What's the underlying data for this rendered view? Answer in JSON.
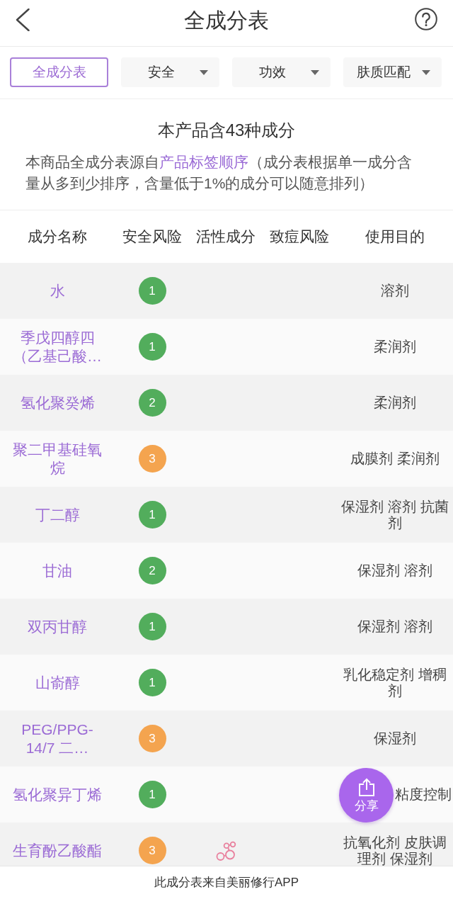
{
  "header": {
    "title": "全成分表"
  },
  "filters": [
    {
      "label": "全成分表",
      "selected": true,
      "dropdown": false
    },
    {
      "label": "安全",
      "selected": false,
      "dropdown": true
    },
    {
      "label": "功效",
      "selected": false,
      "dropdown": true
    },
    {
      "label": "肤质匹配",
      "selected": false,
      "dropdown": true
    }
  ],
  "summary": {
    "title": "本产品含43种成分",
    "text_before": "本商品全成分表源自",
    "link": "产品标签顺序",
    "text_after": "（成分表根据单一成分含量从多到少排序，含量低于1%的成分可以随意排列）"
  },
  "table": {
    "columns": [
      "成分名称",
      "安全风险",
      "活性成分",
      "致痘风险",
      "使用目的"
    ],
    "rows": [
      {
        "name": "水",
        "safety": {
          "score": "1",
          "color": "#52ad5c"
        },
        "active": false,
        "purpose": {
          "text": "溶剂"
        }
      },
      {
        "name": "季戊四醇四（乙基己酸…",
        "safety": {
          "score": "1",
          "color": "#52ad5c"
        },
        "active": false,
        "purpose": {
          "text": "柔润剂"
        }
      },
      {
        "name": "氢化聚癸烯",
        "safety": {
          "score": "2",
          "color": "#52ad5c"
        },
        "active": false,
        "purpose": {
          "text": "柔润剂"
        }
      },
      {
        "name": "聚二甲基硅氧烷",
        "safety": {
          "score": "3",
          "color": "#f4a44f"
        },
        "active": false,
        "purpose": {
          "text": "成膜剂 柔润剂"
        }
      },
      {
        "name": "丁二醇",
        "safety": {
          "score": "1",
          "color": "#52ad5c"
        },
        "active": false,
        "purpose": {
          "text": "保湿剂 溶剂 抗菌剂"
        }
      },
      {
        "name": "甘油",
        "safety": {
          "score": "2",
          "color": "#52ad5c"
        },
        "active": false,
        "purpose": {
          "text": "保湿剂 溶剂"
        }
      },
      {
        "name": "双丙甘醇",
        "safety": {
          "score": "1",
          "color": "#52ad5c"
        },
        "active": false,
        "purpose": {
          "text": "保湿剂 溶剂"
        }
      },
      {
        "name": "山嵛醇",
        "safety": {
          "score": "1",
          "color": "#52ad5c"
        },
        "active": false,
        "purpose": {
          "text": "乳化稳定剂 增稠剂"
        }
      },
      {
        "name": "PEG/PPG-14/7 二…",
        "safety": {
          "score": "3",
          "color": "#f4a44f"
        },
        "active": false,
        "purpose": {
          "text": "保湿剂"
        }
      },
      {
        "name": "氢化聚异丁烯",
        "safety": {
          "score": "1",
          "color": "#52ad5c"
        },
        "active": false,
        "purpose": {
          "text": "粘度控制",
          "partly_covered": true
        }
      },
      {
        "name": "生育酚乙酸酯",
        "safety": {
          "score": "3",
          "color": "#f4a44f"
        },
        "active": true,
        "purpose": {
          "text": "抗氧化剂 皮肤调理剂 保湿剂"
        }
      }
    ]
  },
  "footer": {
    "text": "此成分表来自美丽修行APP"
  },
  "share_button": {
    "label": "分享"
  }
}
